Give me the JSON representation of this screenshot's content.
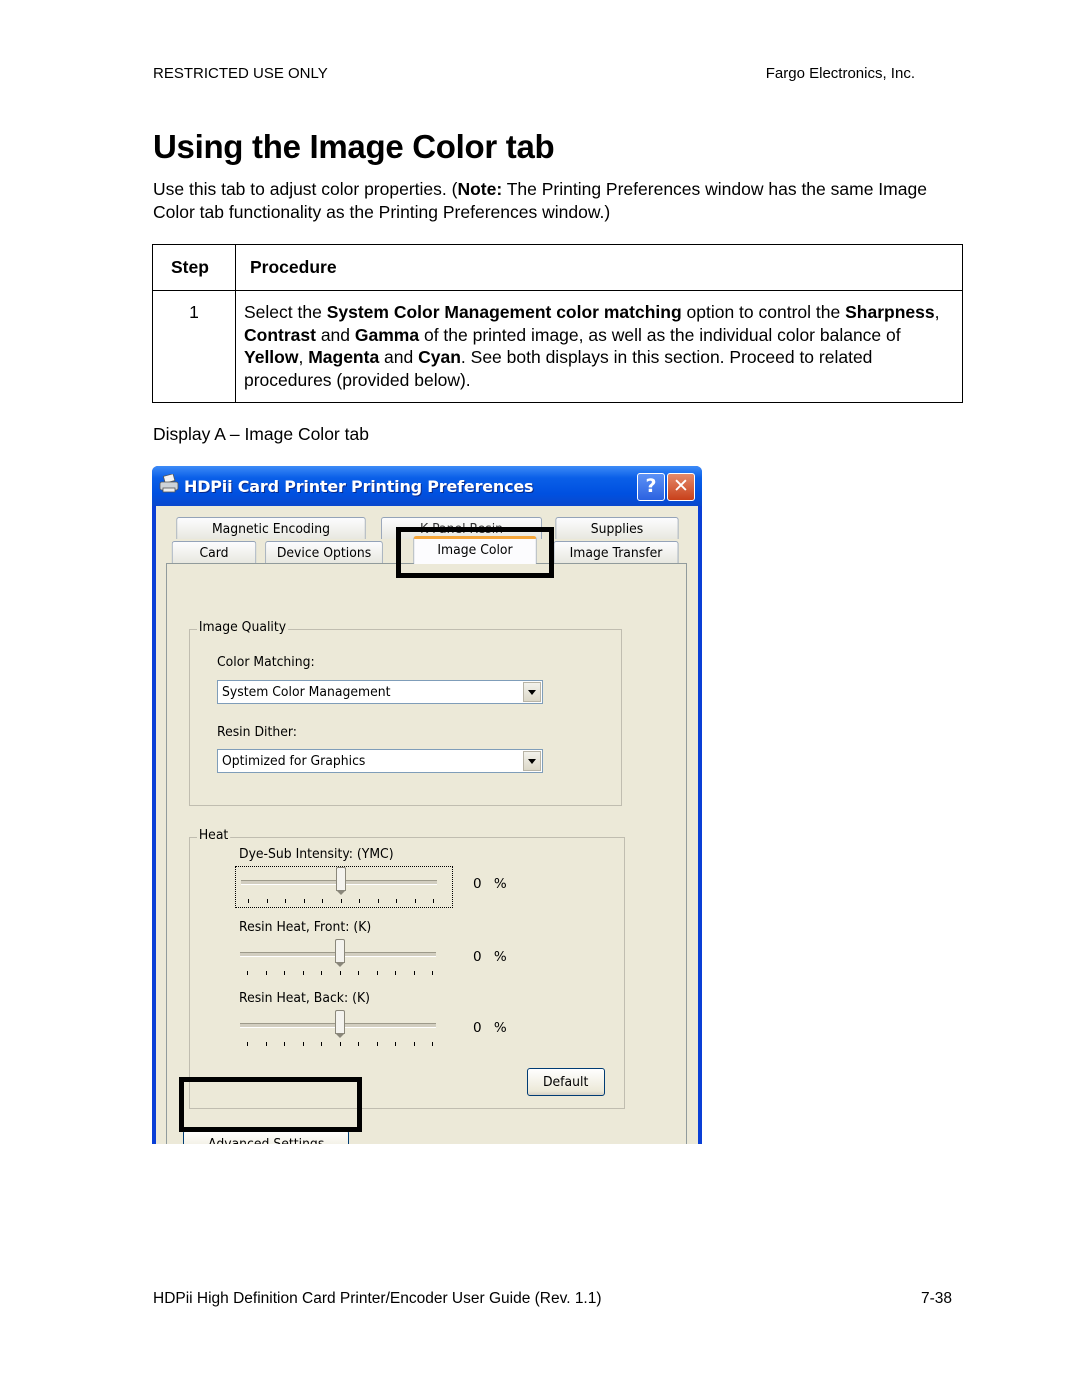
{
  "header": {
    "left": "RESTRICTED USE ONLY",
    "right": "Fargo Electronics, Inc."
  },
  "title": "Using the Image Color tab",
  "intro": {
    "part1": "Use this tab to adjust color properties. (",
    "note_label": "Note:",
    "part2": "  The Printing Preferences window has the same Image Color tab functionality as the  Printing Preferences window.)"
  },
  "procedure_table": {
    "headers": [
      "Step",
      "Procedure"
    ],
    "rows": [
      {
        "step": "1",
        "segments": [
          {
            "text": "Select the ",
            "bold": false
          },
          {
            "text": "System Color Management color matching",
            "bold": true
          },
          {
            "text": " option to control the ",
            "bold": false
          },
          {
            "text": "Sharpness",
            "bold": true
          },
          {
            "text": ", ",
            "bold": false
          },
          {
            "text": "Contrast",
            "bold": true
          },
          {
            "text": " and ",
            "bold": false
          },
          {
            "text": "Gamma",
            "bold": true
          },
          {
            "text": " of the printed image, as well as the individual color balance of ",
            "bold": false
          },
          {
            "text": "Yellow",
            "bold": true
          },
          {
            "text": ", ",
            "bold": false
          },
          {
            "text": "Magenta",
            "bold": true
          },
          {
            "text": " and ",
            "bold": false
          },
          {
            "text": "Cyan",
            "bold": true
          },
          {
            "text": ". See both displays in this section. Proceed to related procedures (provided below).",
            "bold": false
          }
        ]
      }
    ]
  },
  "display_caption": "Display A – Image Color tab",
  "dialog": {
    "title": "HDPii Card Printer Printing Preferences",
    "icons": {
      "app": "printer-icon",
      "help": "help-icon",
      "close": "close-icon"
    },
    "help_label": "?",
    "close_label": "✕",
    "tabs_row1": [
      "Magnetic Encoding",
      "K Panel Resin",
      "Supplies"
    ],
    "tabs_row2": [
      "Card",
      "Device Options",
      "Image Color",
      "Image Transfer"
    ],
    "active_tab": "Image Color",
    "image_quality": {
      "group_label": "Image Quality",
      "color_matching_label": "Color Matching:",
      "color_matching_value": "System Color Management",
      "resin_dither_label": "Resin Dither:",
      "resin_dither_value": "Optimized for Graphics"
    },
    "heat": {
      "group_label": "Heat",
      "sliders": [
        {
          "label": "Dye-Sub Intensity:  (YMC)",
          "value_text": "0 %",
          "position_fraction": 0.5,
          "focused": true
        },
        {
          "label": "Resin Heat, Front: (K)",
          "value_text": "0 %",
          "position_fraction": 0.5,
          "focused": false
        },
        {
          "label": "Resin Heat, Back:    (K)",
          "value_text": "0 %",
          "position_fraction": 0.5,
          "focused": false
        }
      ],
      "default_button": "Default"
    },
    "advanced_button": "Advanced Settings"
  },
  "footer": {
    "left": "HDPii High Definition Card Printer/Encoder User Guide (Rev. 1.1)",
    "right": "7-38"
  }
}
